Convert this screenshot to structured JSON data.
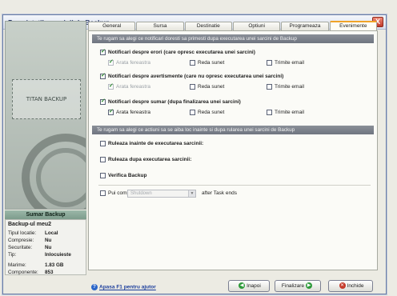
{
  "window": {
    "title": "Proprietatile sarcinii de Backup",
    "close_glyph": "X"
  },
  "left": {
    "logo_text": "TITAN BACKUP",
    "summary_title": "Sumar Backup",
    "backup_name": "Backup-ul meu2",
    "rows": [
      {
        "key": "Tipul locatie:",
        "value": "Local"
      },
      {
        "key": "Compresie:",
        "value": "Nu"
      },
      {
        "key": "Securitate:",
        "value": "Nu"
      },
      {
        "key": "Tip:",
        "value": "Inlocuieste"
      }
    ],
    "rows2": [
      {
        "key": "Marime:",
        "value": "1.83 GB"
      },
      {
        "key": "Componente:",
        "value": "853"
      }
    ]
  },
  "tabs": [
    "General",
    "Sursa",
    "Destinatie",
    "Optiuni",
    "Programeaza",
    "Evenimente"
  ],
  "active_tab": "Evenimente",
  "notifications": {
    "header": "Te rugam sa alegi ce notificari doresti sa primesti dupa executarea unei sarcini de Backup",
    "groups": [
      {
        "title": "Notificari despre erori  (care opresc executarea unei sarcini)",
        "checked": true,
        "options": [
          {
            "label": "Arata fereastra",
            "checked": true,
            "dim": true
          },
          {
            "label": "Reda sunet",
            "checked": false,
            "dim": false
          },
          {
            "label": "Trimite email",
            "checked": false,
            "dim": false
          }
        ]
      },
      {
        "title": "Notificari despre avertismente  (care nu opresc executarea unei sarcini)",
        "checked": true,
        "options": [
          {
            "label": "Arata fereastra",
            "checked": true,
            "dim": true
          },
          {
            "label": "Reda sunet",
            "checked": false,
            "dim": false
          },
          {
            "label": "Trimite email",
            "checked": false,
            "dim": false
          }
        ]
      },
      {
        "title": "Notificari despre sumar  (dupa finalizarea unei sarcini)",
        "checked": true,
        "options": [
          {
            "label": "Arata fereastra",
            "checked": true,
            "dim": false
          },
          {
            "label": "Reda sunet",
            "checked": false,
            "dim": false
          },
          {
            "label": "Trimite email",
            "checked": false,
            "dim": false
          }
        ]
      }
    ]
  },
  "actions": {
    "header": "Te rugam sa alegi ce actiuni sa se aiba loc inainte si dupa rularea unei sarcini de Backup",
    "items": [
      {
        "label": "Ruleaza inainte de executarea sarcinii:",
        "checked": false
      },
      {
        "label": "Ruleaza dupa executarea sarcinii:",
        "checked": false
      },
      {
        "label": "Verifica Backup",
        "checked": false
      }
    ],
    "computer_label": "Pui computer in:",
    "computer_select": "Shutdown",
    "computer_suffix": "after Task ends"
  },
  "footer": {
    "help": "Apasa F1 pentru ajutor",
    "back": "Inapoi",
    "finish": "Finalizare",
    "close": "Inchide"
  },
  "colors": {
    "active_tab_accent": "#f0a428",
    "section_bar": "#7a808a",
    "title_text": "#2b3a66"
  }
}
